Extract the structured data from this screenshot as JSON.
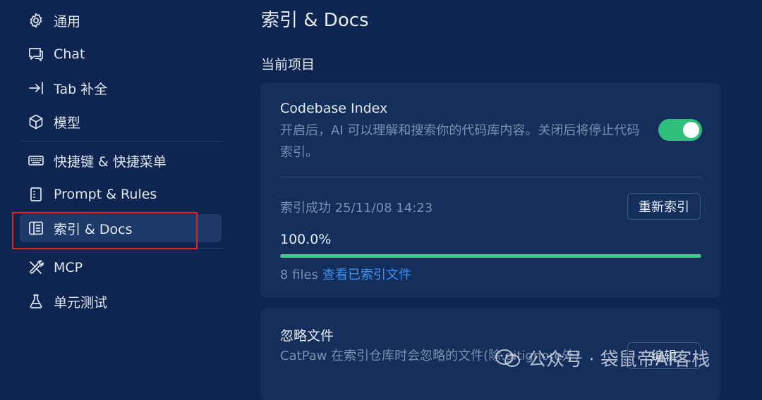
{
  "sidebar": {
    "items": [
      {
        "label": "通用",
        "icon": "gear-icon"
      },
      {
        "label": "Chat",
        "icon": "chat-bubble-icon"
      },
      {
        "label": "Tab 补全",
        "icon": "tab-arrow-icon"
      },
      {
        "label": "模型",
        "icon": "cube-icon"
      },
      {
        "label": "快捷键 & 快捷菜单",
        "icon": "keyboard-icon"
      },
      {
        "label": "Prompt & Rules",
        "icon": "notebook-icon"
      },
      {
        "label": "索引 & Docs",
        "icon": "book-index-icon",
        "active": true
      },
      {
        "label": "MCP",
        "icon": "tools-icon"
      },
      {
        "label": "单元测试",
        "icon": "flask-icon"
      }
    ]
  },
  "main": {
    "title": "索引 & Docs",
    "section_title": "当前项目",
    "codebase": {
      "heading": "Codebase Index",
      "description": "开启后，AI 可以理解和搜索你的代码库内容。关闭后将停止代码索引。",
      "toggle_on": true,
      "status": "索引成功 25/11/08 14:23",
      "reindex_label": "重新索引",
      "progress_label": "100.0%",
      "progress_fraction": 1.0,
      "files_count": "8 files",
      "files_link": "查看已索引文件"
    },
    "ignore": {
      "heading": "忽略文件",
      "description": "CatPaw 在索引仓库时会忽略的文件(除.gitignore外)",
      "edit_label": "编辑"
    }
  },
  "watermark": "公众号 · 袋鼠帝AI客栈",
  "colors": {
    "background": "#0d2550",
    "card": "#142f5c",
    "toggle": "#2fbf7a",
    "progress": "#45c98a",
    "link": "#3d8ff0",
    "highlight": "#e0262b"
  }
}
